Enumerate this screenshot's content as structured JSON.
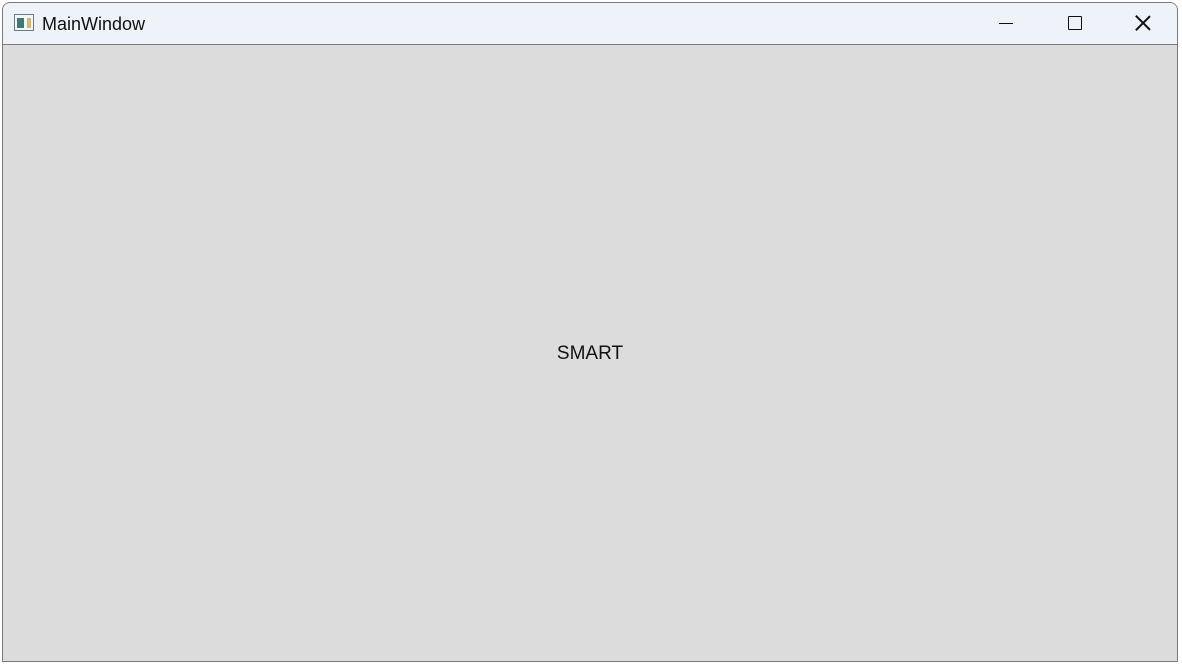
{
  "window": {
    "title": "MainWindow",
    "app_icon": "app-window-icon",
    "controls": {
      "minimize_icon": "minimize-icon",
      "maximize_icon": "maximize-icon",
      "close_icon": "close-icon"
    }
  },
  "content": {
    "label": "SMART"
  },
  "colors": {
    "titlebar_bg": "#eef3f9",
    "client_bg": "#dcdcdc",
    "border": "#7a7a7a",
    "text": "#111111"
  }
}
